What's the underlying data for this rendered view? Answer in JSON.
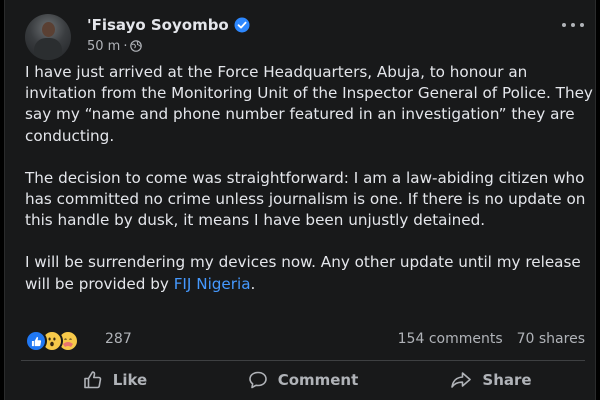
{
  "post": {
    "author": "'Fisayo Soyombo",
    "time": "50 m",
    "audience_icon": "globe-icon",
    "verified_icon": "verified-badge-icon",
    "paragraphs": [
      "I have just arrived at the Force Headquarters, Abuja, to honour an invitation from the Monitoring Unit of the Inspector General of Police. They say my “name and phone number featured in an investigation” they are conducting.",
      "The decision to come was straightforward: I am a law-abiding citizen who has committed no crime unless journalism is one. If there is no update on this handle by dusk, it means I have been unjustly detained."
    ],
    "last_paragraph_prefix": "I will be surrendering my devices now. Any other update until my release will be provided by ",
    "mention": "FIJ Nigeria",
    "last_paragraph_suffix": "."
  },
  "stats": {
    "reaction_count": "287",
    "comments": "154 comments",
    "shares": "70 shares",
    "reaction_icons": [
      "like-reaction-icon",
      "wow-reaction-icon",
      "care-reaction-icon"
    ]
  },
  "actions": {
    "like": "Like",
    "comment": "Comment",
    "share": "Share"
  },
  "colors": {
    "background": "#18191a",
    "text": "#e4e6eb",
    "secondary_text": "#b0b3b8",
    "link": "#4599ff",
    "verified": "#2d88ff"
  }
}
